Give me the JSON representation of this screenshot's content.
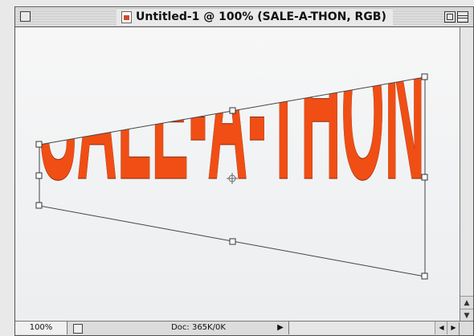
{
  "window": {
    "title": "Untitled-1 @ 100% (SALE-A-THON, RGB)"
  },
  "canvas": {
    "artwork_text": "SALE-A-THON",
    "text_color": "#f04e14"
  },
  "status_bar": {
    "zoom_level": "100%",
    "doc_info": "Doc: 365K/0K",
    "menu_arrow": "▶"
  },
  "scrollbar": {
    "up_arrow": "▲",
    "down_arrow": "▼",
    "left_arrow": "◀",
    "right_arrow": "▶"
  },
  "icons": {
    "close": "close-box-icon",
    "document": "document-icon",
    "zoom": "zoom-box-icon",
    "collapse": "collapse-box-icon"
  }
}
